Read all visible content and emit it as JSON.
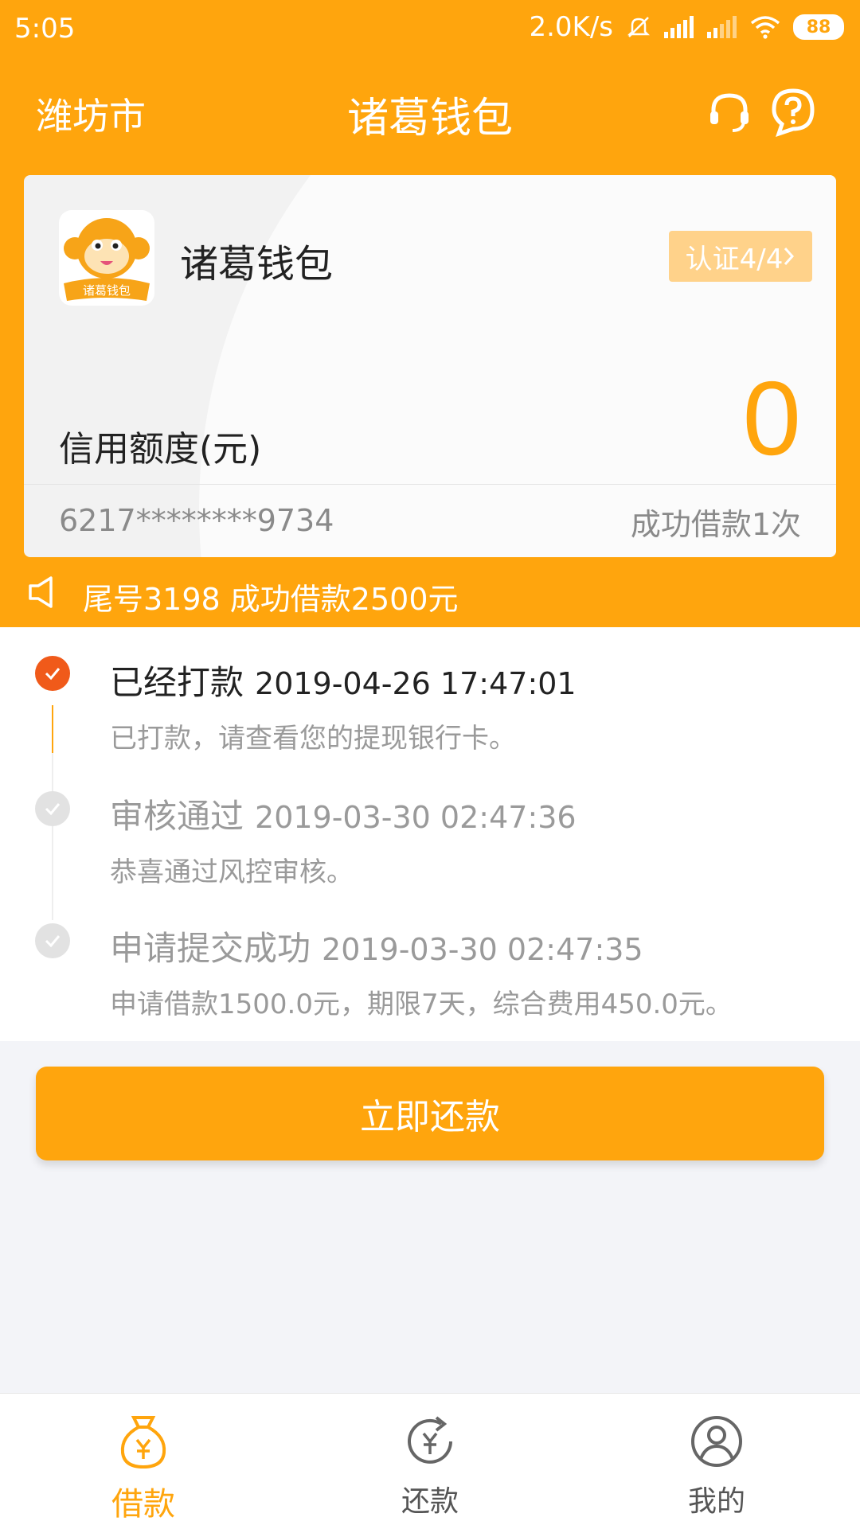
{
  "status_bar": {
    "time": "5:05",
    "net_speed": "2.0K/s",
    "battery": "88"
  },
  "header": {
    "city": "潍坊市",
    "title": "诸葛钱包",
    "icons": [
      "headset-icon",
      "help-icon"
    ]
  },
  "card": {
    "logo_text": "诸葛钱包",
    "brand_name": "诸葛钱包",
    "cert_badge": "认证4/4",
    "credit_label": "信用额度(元)",
    "credit_value": "0",
    "card_number": "6217********9734",
    "success_count": "成功借款1次"
  },
  "notice": {
    "text": "尾号3198 成功借款2500元"
  },
  "timeline": [
    {
      "title": "已经打款",
      "time": "2019-04-26 17:47:01",
      "desc": "已打款，请查看您的提现银行卡。",
      "state": "active"
    },
    {
      "title": "审核通过",
      "time": "2019-03-30 02:47:36",
      "desc": "恭喜通过风控审核。",
      "state": "inactive"
    },
    {
      "title": "申请提交成功",
      "time": "2019-03-30 02:47:35",
      "desc": "申请借款1500.0元，期限7天，综合费用450.0元。",
      "state": "inactive"
    }
  ],
  "repay_button": "立即还款",
  "bottom_nav": [
    {
      "label": "借款",
      "icon": "loan-bag-icon",
      "active": true
    },
    {
      "label": "还款",
      "icon": "repay-icon",
      "active": false
    },
    {
      "label": "我的",
      "icon": "profile-icon",
      "active": false
    }
  ],
  "colors": {
    "brand": "#ffa50d",
    "active_dot": "#f05a1a",
    "badge": "#ffd28a"
  }
}
